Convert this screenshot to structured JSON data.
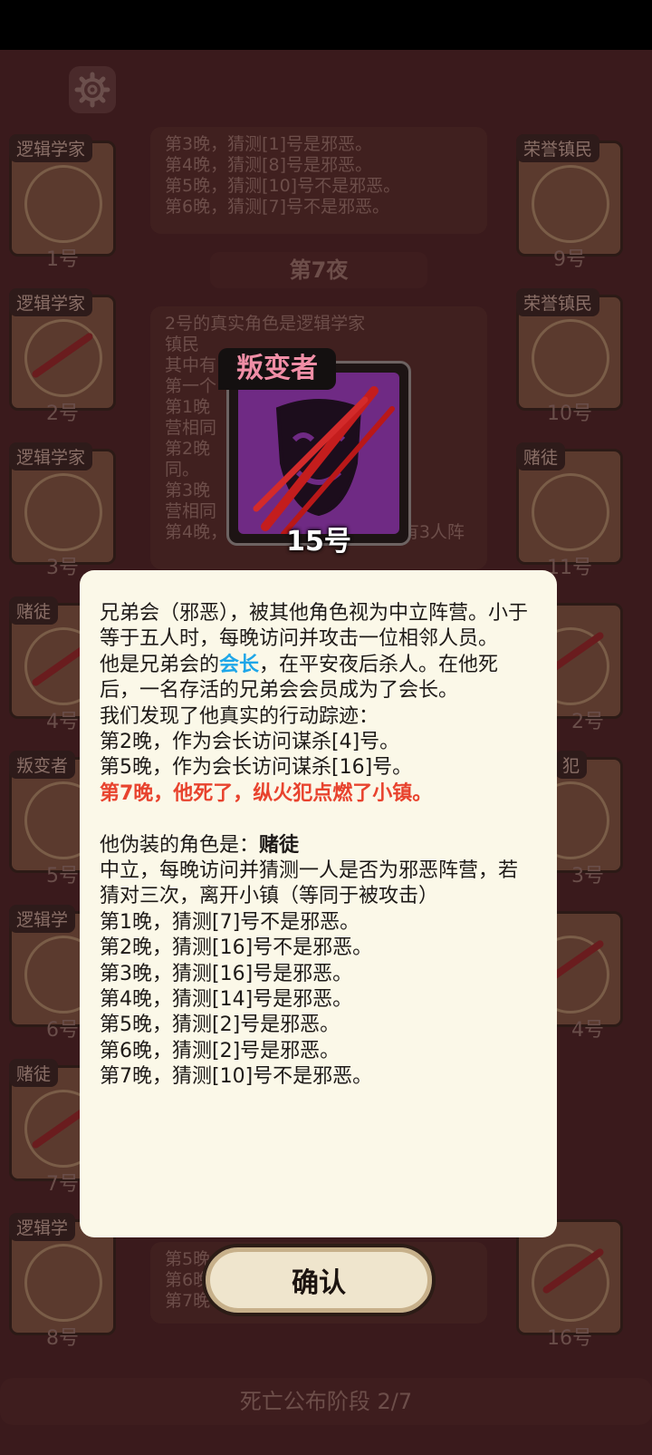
{
  "left_column": [
    {
      "tag": "逻辑学家",
      "num": "1号"
    },
    {
      "tag": "逻辑学家",
      "num": "2号"
    },
    {
      "tag": "逻辑学家",
      "num": "3号"
    },
    {
      "tag": "赌徒",
      "num": "4号"
    },
    {
      "tag": "叛变者",
      "num": "5号"
    },
    {
      "tag": "逻辑学",
      "num": "6号"
    },
    {
      "tag": "赌徒",
      "num": "7号"
    },
    {
      "tag": "逻辑学",
      "num": "8号"
    }
  ],
  "right_column": [
    {
      "tag": "荣誉镇民",
      "num": "9号"
    },
    {
      "tag": "荣誉镇民",
      "num": "10号"
    },
    {
      "tag": "赌徒",
      "num": "11号"
    },
    {
      "tag": "",
      "num": "2号"
    },
    {
      "tag": "犯",
      "num": "3号"
    },
    {
      "tag": "",
      "num": "4号"
    },
    {
      "tag": "",
      "num": ""
    },
    {
      "tag": "",
      "num": "16号"
    }
  ],
  "log_top": [
    "第3晚，猜测[1]号是邪恶。",
    "第4晚，猜测[8]号是邪恶。",
    "第5晚，猜测[10]号不是邪恶。",
    "第6晚，猜测[7]号不是邪恶。"
  ],
  "night_label": "第7夜",
  "log_mid": [
    "2号的真实角色是逻辑学家",
    "镇民",
    "其中有",
    "第一个",
    "第1晚",
    "营相同",
    "第2晚",
    "同。",
    "第3晚",
    "营相同",
    "第4晚，[1]号，[?]号，[0]号中有3人阵"
  ],
  "log_bottom": [
    "第5晚",
    "第6晚",
    "第7晚"
  ],
  "phase_label": "死亡公布阶段 2/7",
  "hero": {
    "tag": "叛变者",
    "num": "15号"
  },
  "dialog": {
    "line1": "兄弟会（邪恶），被其他角色视为中立阵营。小于等于五人时，每晚访问并攻击一位相邻人员。",
    "line2_pre": "他是兄弟会的",
    "line2_hl": "会长",
    "line2_post": "，在平安夜后杀人。在他死后，一名存活的兄弟会会员成为了会长。",
    "line3": "我们发现了他真实的行动踪迹：",
    "line4": "第2晚，作为会长访问谋杀[4]号。",
    "line5": "第5晚，作为会长访问谋杀[16]号。",
    "line6": "第7晚，他死了，纵火犯点燃了小镇。",
    "disguise_pre": "他伪装的角色是：",
    "disguise_role": "赌徒",
    "role_desc": "中立，每晚访问并猜测一人是否为邪恶阵营，若猜对三次，离开小镇（等同于被攻击）",
    "guesses": [
      "第1晚，猜测[7]号不是邪恶。",
      "第2晚，猜测[16]号不是邪恶。",
      "第3晚，猜测[16]号是邪恶。",
      "第4晚，猜测[14]号是邪恶。",
      "第5晚，猜测[2]号是邪恶。",
      "第6晚，猜测[2]号是邪恶。",
      "第7晚，猜测[10]号不是邪恶。"
    ]
  },
  "confirm_label": "确认"
}
